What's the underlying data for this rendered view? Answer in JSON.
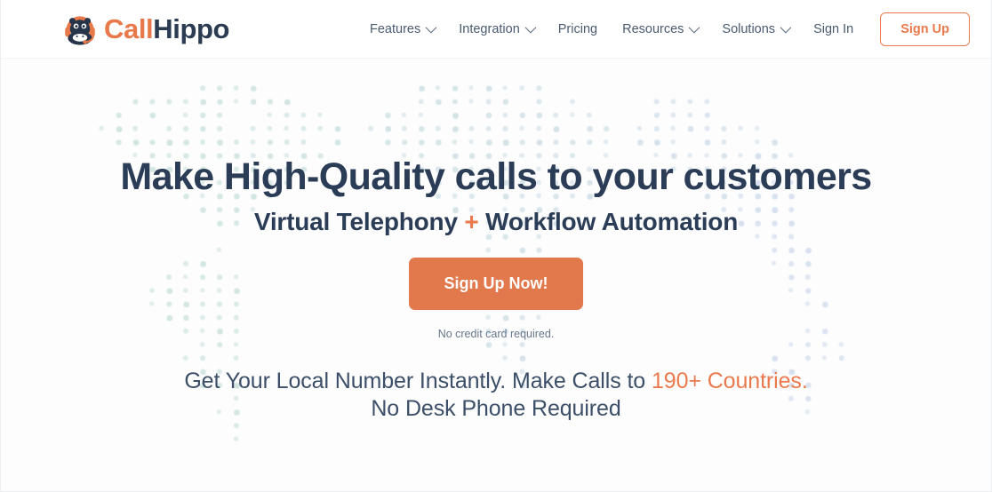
{
  "brand": {
    "logo_icon": "hippo-headset-icon",
    "name_part1": "Call",
    "name_part2": "Hippo",
    "color_orange": "#ea7a4d",
    "color_navy": "#2b3c52"
  },
  "header": {
    "nav_items": [
      {
        "label": "Features",
        "has_dropdown": true,
        "name": "features"
      },
      {
        "label": "Integration",
        "has_dropdown": true,
        "name": "integration"
      },
      {
        "label": "Pricing",
        "has_dropdown": false,
        "name": "pricing"
      },
      {
        "label": "Resources",
        "has_dropdown": true,
        "name": "resources"
      },
      {
        "label": "Solutions",
        "has_dropdown": true,
        "name": "solutions"
      },
      {
        "label": "Sign In",
        "has_dropdown": false,
        "name": "sign-in"
      }
    ],
    "signup_label": "Sign Up"
  },
  "hero": {
    "headline": "Make High-Quality calls to your customers",
    "subheadline_part1": "Virtual Telephony ",
    "subheadline_plus": "+",
    "subheadline_part2": " Workflow Automation",
    "cta_label": "Sign Up Now!",
    "no_credit_card": "No credit card required.",
    "tagline_line1_part1": "Get Your Local Number Instantly. Make Calls to ",
    "tagline_line1_highlight": "190+ Countries.",
    "tagline_line2": "No Desk Phone Required",
    "background": "dotted-world-map"
  }
}
